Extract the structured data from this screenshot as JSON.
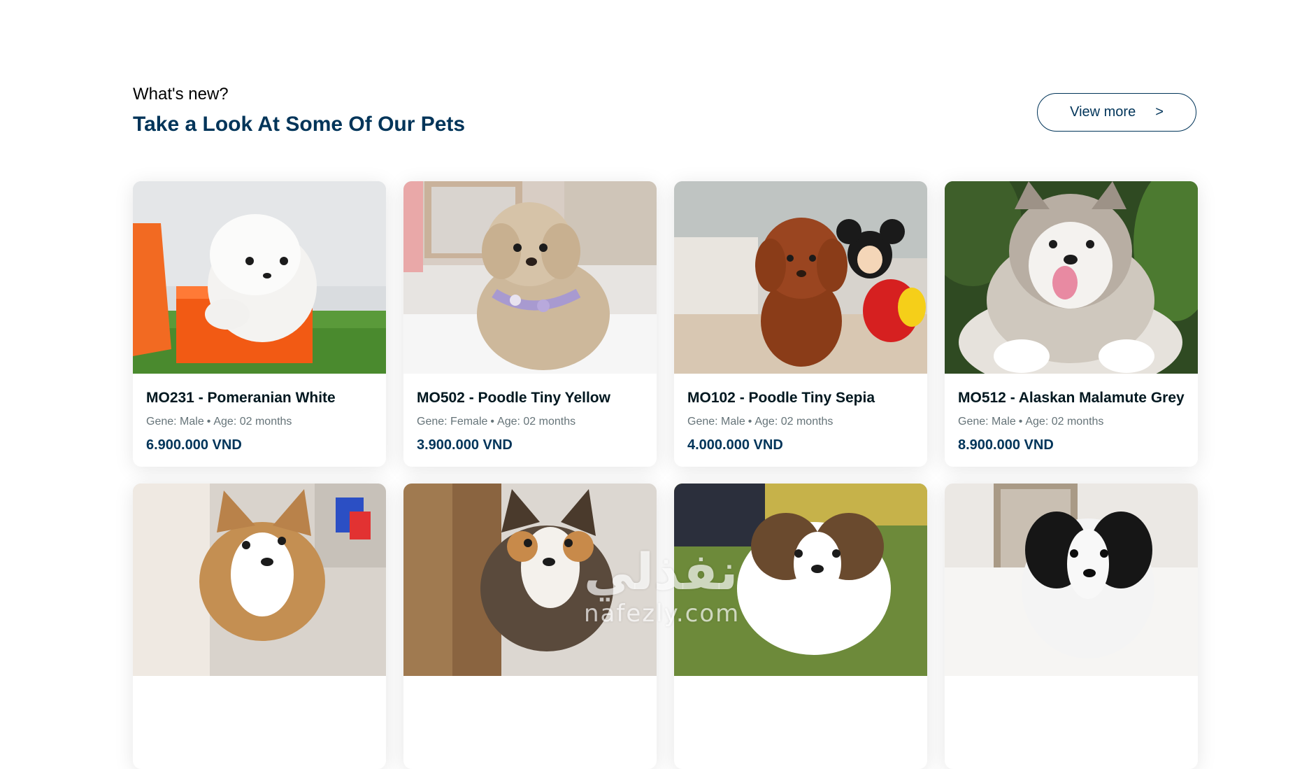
{
  "header": {
    "eyebrow": "What's new?",
    "title": "Take a Look At Some Of Our Pets",
    "view_more_label": "View more",
    "view_more_chevron": ">"
  },
  "colors": {
    "primary": "#003459",
    "text_dark": "#00171F",
    "text_muted": "#667479"
  },
  "pets": [
    {
      "name": "MO231 - Pomeranian White",
      "gene_label": "Gene:",
      "gene": "Male",
      "age_label": "Age:",
      "age": "02 months",
      "price": "6.900.000 VND"
    },
    {
      "name": "MO502 - Poodle Tiny Yellow",
      "gene_label": "Gene:",
      "gene": "Female",
      "age_label": "Age:",
      "age": "02 months",
      "price": "3.900.000 VND"
    },
    {
      "name": "MO102 - Poodle Tiny Sepia",
      "gene_label": "Gene:",
      "gene": "Male",
      "age_label": "Age:",
      "age": "02 months",
      "price": "4.000.000 VND"
    },
    {
      "name": "MO512 - Alaskan Malamute Grey",
      "gene_label": "Gene:",
      "gene": "Male",
      "age_label": "Age:",
      "age": "02 months",
      "price": "8.900.000 VND"
    }
  ],
  "watermark": {
    "arabic": "نفذلي",
    "latin": "nafezly.com"
  }
}
